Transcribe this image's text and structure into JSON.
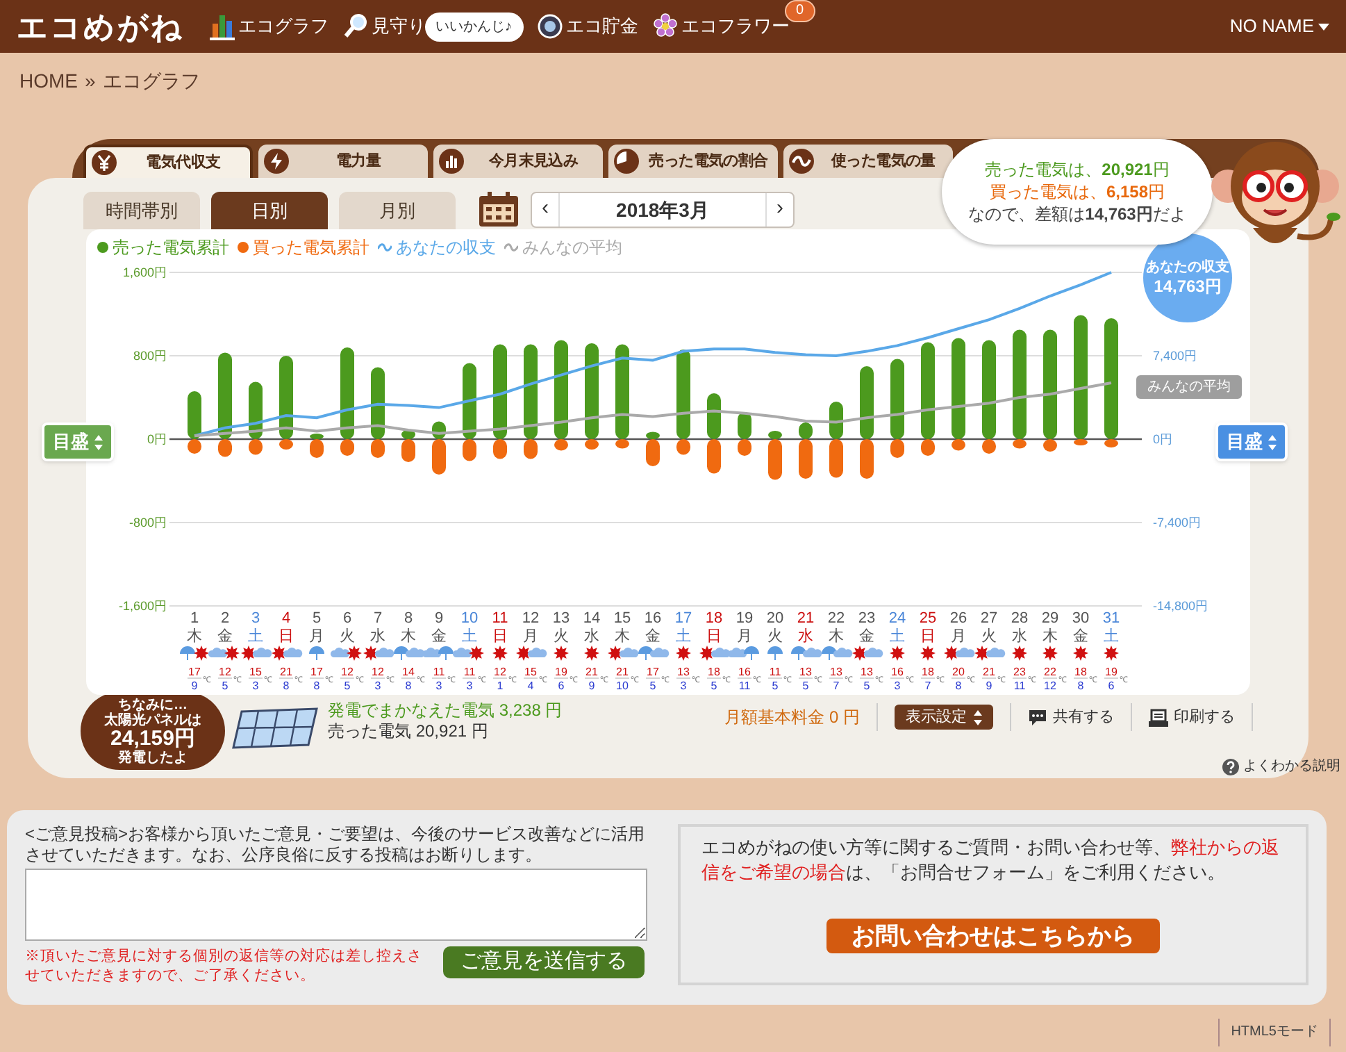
{
  "header": {
    "logo": "エコめがね",
    "nav": [
      {
        "label": "エコグラフ"
      },
      {
        "label": "見守り",
        "badge": "いいかんじ♪"
      },
      {
        "label": "エコ貯金"
      },
      {
        "label": "エコフラワー",
        "count": "0"
      }
    ],
    "user": "NO NAME"
  },
  "breadcrumb": {
    "items": [
      "HOME",
      "エコグラフ"
    ],
    "separator": "»"
  },
  "main_tabs": [
    {
      "label": "電気代収支",
      "selected": true
    },
    {
      "label": "電力量",
      "selected": false
    },
    {
      "label": "今月末見込み",
      "selected": false
    },
    {
      "label": "売った電気の割合",
      "selected": false
    },
    {
      "label": "使った電気の量",
      "selected": false
    }
  ],
  "sub_tabs": [
    {
      "label": "時間帯別",
      "selected": false
    },
    {
      "label": "日別",
      "selected": true
    },
    {
      "label": "月別",
      "selected": false
    }
  ],
  "date_nav": {
    "prev": "‹",
    "label": "2018年3月",
    "next": "›"
  },
  "summary_bubble": [
    {
      "kind": "sold",
      "text": "売った電気は、**20,921**円"
    },
    {
      "kind": "bought",
      "text": "買った電気は、**6,158**円"
    },
    {
      "kind": "balance",
      "text": "なので、差額は**14,763円**だよ"
    }
  ],
  "chart": {
    "scale_buttons": [
      "目盛",
      "目盛"
    ],
    "balance_tag": {
      "title": "あなたの収支",
      "value": "14,763円"
    },
    "average_tag": "みんなの平均",
    "days": [
      {
        "weekday": "木",
        "color": "#555555",
        "weather": [
          {
            "kind": "rain"
          },
          {
            "kind": "sun"
          }
        ],
        "high": "17",
        "low": "9",
        "unit": "℃"
      },
      {
        "weekday": "金",
        "color": "#555555",
        "weather": [
          {
            "kind": "cloud"
          },
          {
            "kind": "sun"
          }
        ],
        "high": "12",
        "low": "5",
        "unit": "℃"
      },
      {
        "weekday": "土",
        "color": "#4a86d8",
        "weather": [
          {
            "kind": "sun"
          },
          {
            "kind": "cloud"
          }
        ],
        "high": "15",
        "low": "3",
        "unit": "℃"
      },
      {
        "weekday": "日",
        "color": "#cc1010",
        "weather": [
          {
            "kind": "sun"
          },
          {
            "kind": "cloud"
          }
        ],
        "high": "21",
        "low": "8",
        "unit": "℃"
      },
      {
        "weekday": "月",
        "color": "#555555",
        "weather": [
          {
            "kind": "rain"
          }
        ],
        "high": "17",
        "low": "8",
        "unit": "℃"
      },
      {
        "weekday": "火",
        "color": "#555555",
        "weather": [
          {
            "kind": "cloud"
          },
          {
            "kind": "sun"
          }
        ],
        "high": "12",
        "low": "5",
        "unit": "℃"
      },
      {
        "weekday": "水",
        "color": "#555555",
        "weather": [
          {
            "kind": "sun"
          },
          {
            "kind": "cloud"
          }
        ],
        "high": "12",
        "low": "3",
        "unit": "℃"
      },
      {
        "weekday": "木",
        "color": "#555555",
        "weather": [
          {
            "kind": "rain"
          },
          {
            "kind": "cloud"
          }
        ],
        "high": "14",
        "low": "8",
        "unit": "℃"
      },
      {
        "weekday": "金",
        "color": "#555555",
        "weather": [
          {
            "kind": "cloud"
          },
          {
            "kind": "rain"
          }
        ],
        "high": "11",
        "low": "3",
        "unit": "℃"
      },
      {
        "weekday": "土",
        "color": "#4a86d8",
        "weather": [
          {
            "kind": "cloud"
          },
          {
            "kind": "sun"
          }
        ],
        "high": "11",
        "low": "3",
        "unit": "℃"
      },
      {
        "weekday": "日",
        "color": "#cc1010",
        "weather": [
          {
            "kind": "sun"
          }
        ],
        "high": "12",
        "low": "1",
        "unit": "℃"
      },
      {
        "weekday": "月",
        "color": "#555555",
        "weather": [
          {
            "kind": "sun"
          },
          {
            "kind": "cloud"
          }
        ],
        "high": "15",
        "low": "4",
        "unit": "℃"
      },
      {
        "weekday": "火",
        "color": "#555555",
        "weather": [
          {
            "kind": "sun"
          }
        ],
        "high": "19",
        "low": "6",
        "unit": "℃"
      },
      {
        "weekday": "水",
        "color": "#555555",
        "weather": [
          {
            "kind": "sun"
          }
        ],
        "high": "21",
        "low": "9",
        "unit": "℃"
      },
      {
        "weekday": "木",
        "color": "#555555",
        "weather": [
          {
            "kind": "sun"
          },
          {
            "kind": "cloud"
          }
        ],
        "high": "21",
        "low": "10",
        "unit": "℃"
      },
      {
        "weekday": "金",
        "color": "#555555",
        "weather": [
          {
            "kind": "rain"
          },
          {
            "kind": "cloud"
          }
        ],
        "high": "17",
        "low": "5",
        "unit": "℃"
      },
      {
        "weekday": "土",
        "color": "#4a86d8",
        "weather": [
          {
            "kind": "sun"
          }
        ],
        "high": "13",
        "low": "3",
        "unit": "℃"
      },
      {
        "weekday": "日",
        "color": "#cc1010",
        "weather": [
          {
            "kind": "sun"
          },
          {
            "kind": "cloud"
          }
        ],
        "high": "18",
        "low": "5",
        "unit": "℃"
      },
      {
        "weekday": "月",
        "color": "#555555",
        "weather": [
          {
            "kind": "cloud"
          },
          {
            "kind": "rain"
          }
        ],
        "high": "16",
        "low": "11",
        "unit": "℃"
      },
      {
        "weekday": "火",
        "color": "#555555",
        "weather": [
          {
            "kind": "rain"
          }
        ],
        "high": "11",
        "low": "5",
        "unit": "℃"
      },
      {
        "weekday": "水",
        "color": "#cc1010",
        "weather": [
          {
            "kind": "rain"
          },
          {
            "kind": "cloud"
          }
        ],
        "high": "13",
        "low": "5",
        "unit": "℃"
      },
      {
        "weekday": "木",
        "color": "#555555",
        "weather": [
          {
            "kind": "rain"
          },
          {
            "kind": "cloud"
          }
        ],
        "high": "13",
        "low": "7",
        "unit": "℃"
      },
      {
        "weekday": "金",
        "color": "#555555",
        "weather": [
          {
            "kind": "sun"
          },
          {
            "kind": "cloud"
          }
        ],
        "high": "13",
        "low": "5",
        "unit": "℃"
      },
      {
        "weekday": "土",
        "color": "#4a86d8",
        "weather": [
          {
            "kind": "sun"
          }
        ],
        "high": "16",
        "low": "3",
        "unit": "℃"
      },
      {
        "weekday": "日",
        "color": "#cc1010",
        "weather": [
          {
            "kind": "sun"
          }
        ],
        "high": "18",
        "low": "7",
        "unit": "℃"
      },
      {
        "weekday": "月",
        "color": "#555555",
        "weather": [
          {
            "kind": "sun"
          },
          {
            "kind": "cloud"
          }
        ],
        "high": "20",
        "low": "8",
        "unit": "℃"
      },
      {
        "weekday": "火",
        "color": "#555555",
        "weather": [
          {
            "kind": "sun"
          },
          {
            "kind": "cloud"
          }
        ],
        "high": "21",
        "low": "9",
        "unit": "℃"
      },
      {
        "weekday": "水",
        "color": "#555555",
        "weather": [
          {
            "kind": "sun"
          }
        ],
        "high": "23",
        "low": "11",
        "unit": "℃"
      },
      {
        "weekday": "木",
        "color": "#555555",
        "weather": [
          {
            "kind": "sun"
          }
        ],
        "high": "22",
        "low": "12",
        "unit": "℃"
      },
      {
        "weekday": "金",
        "color": "#555555",
        "weather": [
          {
            "kind": "sun"
          }
        ],
        "high": "18",
        "low": "8",
        "unit": "℃"
      },
      {
        "weekday": "土",
        "color": "#4a86d8",
        "weather": [
          {
            "kind": "sun"
          }
        ],
        "high": "19",
        "low": "6",
        "unit": "℃"
      }
    ],
    "chart_data": {
      "type": "bar",
      "stacked": true,
      "legend": "top",
      "categories": [
        "1",
        "2",
        "3",
        "4",
        "5",
        "6",
        "7",
        "8",
        "9",
        "10",
        "11",
        "12",
        "13",
        "14",
        "15",
        "16",
        "17",
        "18",
        "19",
        "20",
        "21",
        "22",
        "23",
        "24",
        "25",
        "26",
        "27",
        "28",
        "29",
        "30",
        "31"
      ],
      "ylim": [
        -1600,
        1600
      ],
      "yticks": [
        {
          "value": 1600,
          "label": "1,600円"
        },
        {
          "value": 800,
          "label": "800円"
        },
        {
          "value": 0,
          "label": "0円"
        },
        {
          "value": -800,
          "label": "-800円"
        },
        {
          "value": -1600,
          "label": "-1,600円"
        }
      ],
      "y2lim": [
        -14800,
        14800
      ],
      "y2ticks": [
        {
          "value": 7400,
          "label": "7,400円"
        },
        {
          "value": 0,
          "label": "0円"
        },
        {
          "value": -7400,
          "label": "-7,400円"
        },
        {
          "value": -14800,
          "label": "-14,800円"
        }
      ],
      "series": [
        {
          "name": "売った電気累計",
          "type": "bar",
          "color": "#4c9a1e",
          "values": [
            460,
            830,
            550,
            800,
            40,
            880,
            690,
            90,
            170,
            730,
            910,
            910,
            950,
            920,
            910,
            70,
            860,
            440,
            260,
            80,
            160,
            360,
            700,
            770,
            930,
            970,
            950,
            1050,
            1050,
            1190,
            1160
          ]
        },
        {
          "name": "買った電気累計",
          "type": "bar",
          "color": "#f06a10",
          "values": [
            -140,
            -170,
            -150,
            -100,
            -180,
            -160,
            -180,
            -220,
            -340,
            -210,
            -190,
            -190,
            -110,
            -100,
            -90,
            -260,
            -150,
            -330,
            -160,
            -390,
            -380,
            -370,
            -380,
            -180,
            -160,
            -110,
            -140,
            -90,
            -120,
            -60,
            -80
          ]
        },
        {
          "name": "あなたの収支",
          "type": "line",
          "axis": "y2",
          "color": "#5aa8e8",
          "values": [
            300,
            1000,
            1400,
            2100,
            1900,
            2600,
            3100,
            3000,
            2800,
            3400,
            4000,
            4900,
            5700,
            6500,
            7200,
            7000,
            7800,
            8000,
            8000,
            7700,
            7500,
            7400,
            7800,
            8300,
            9000,
            9800,
            10600,
            11600,
            12700,
            13700,
            14800
          ]
        },
        {
          "name": "みんなの平均",
          "type": "line",
          "axis": "y2",
          "color": "#aaaaaa",
          "values": [
            300,
            500,
            700,
            1000,
            700,
            1000,
            1200,
            800,
            500,
            700,
            900,
            1200,
            1500,
            1900,
            2200,
            2000,
            2300,
            2500,
            2300,
            2000,
            1600,
            1500,
            1900,
            2200,
            2600,
            2900,
            3200,
            3700,
            4000,
            4500,
            5000
          ]
        }
      ]
    }
  },
  "bottom": {
    "solar_bubble": [
      "ちなみに…",
      "太陽光パネルは",
      "24,159円",
      "発電したよ"
    ],
    "generated": "発電でまかなえた電気 3,238 円",
    "sold": "売った電気 20,921 円",
    "base_fee": "月額基本料金 0 円",
    "actions": [
      {
        "kind": "select",
        "label": "表示設定"
      },
      {
        "kind": "share",
        "label": "共有する"
      },
      {
        "kind": "print",
        "label": "印刷する"
      }
    ],
    "help": "よくわかる説明"
  },
  "feedback": {
    "intro": "<ご意見投稿>お客様から頂いたご意見・ご要望は、今後のサービス改善などに活用させていただきます。なお、公序良俗に反する投稿はお断りします。",
    "note": "※頂いたご意見に対する個別の返信等の対応は差し控えさせていただきますので、ご了承ください。",
    "button": "ご意見を送信する"
  },
  "contact": {
    "text": "エコめがねの使い方等に関するご質問・お問い合わせ等、**弊社からの返信をご希望の場合**は、「お問合せフォーム」をご利用ください。",
    "button": "お問い合わせはこちらから"
  },
  "mode_link": "HTML5モード"
}
